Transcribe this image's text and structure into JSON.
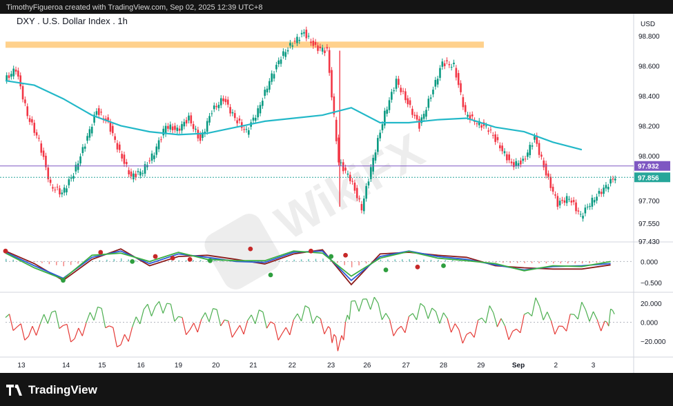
{
  "header": {
    "attribution": "TimothyFigueroa created with TradingView.com, Sep 02, 2025 12:39 UTC+8"
  },
  "brand": {
    "name": "TradingView"
  },
  "chart_data": {
    "type": "candlestick",
    "title": "DXY . U.S. Dollar Index . 1h",
    "currency": "USD",
    "x_ticks": [
      "13",
      "14",
      "15",
      "16",
      "19",
      "20",
      "21",
      "22",
      "23",
      "26",
      "27",
      "28",
      "29",
      "Sep",
      "2",
      "3"
    ],
    "price_ticks": [
      "98.800",
      "98.600",
      "98.400",
      "98.200",
      "98.000",
      "97.700",
      "97.550",
      "97.430"
    ],
    "price_ticks_values": [
      98.8,
      98.6,
      98.4,
      98.2,
      98.0,
      97.7,
      97.55,
      97.43
    ],
    "ylim": [
      97.43,
      98.9
    ],
    "price_labels": [
      {
        "text": "97.932",
        "value": 97.932,
        "color": "#7e57c2"
      },
      {
        "text": "97.856",
        "value": 97.856,
        "color": "#26a69a"
      }
    ],
    "resistance_zone": {
      "value": 98.74
    },
    "moving_average": {
      "color": "#22b8c8",
      "points": [
        [
          0,
          98.5
        ],
        [
          1,
          98.47
        ],
        [
          2,
          98.38
        ],
        [
          3,
          98.27
        ],
        [
          4,
          98.2
        ],
        [
          5,
          98.16
        ],
        [
          6,
          98.14
        ],
        [
          7,
          98.15
        ],
        [
          8,
          98.19
        ],
        [
          9,
          98.23
        ],
        [
          10,
          98.25
        ],
        [
          11,
          98.27
        ],
        [
          12,
          98.32
        ],
        [
          13,
          98.22
        ],
        [
          14,
          98.22
        ],
        [
          15,
          98.24
        ],
        [
          16,
          98.25
        ],
        [
          17,
          98.19
        ],
        [
          18,
          98.16
        ],
        [
          19,
          98.09
        ],
        [
          20,
          98.04
        ]
      ]
    },
    "price_series": [
      [
        0,
        98.5
      ],
      [
        0.4,
        98.58
      ],
      [
        0.8,
        98.27
      ],
      [
        1.2,
        98.1
      ],
      [
        1.6,
        97.8
      ],
      [
        2,
        97.75
      ],
      [
        2.4,
        97.88
      ],
      [
        2.8,
        98.08
      ],
      [
        3.2,
        98.3
      ],
      [
        3.6,
        98.22
      ],
      [
        4,
        98.02
      ],
      [
        4.4,
        97.86
      ],
      [
        4.8,
        97.9
      ],
      [
        5.2,
        98.02
      ],
      [
        5.6,
        98.2
      ],
      [
        6,
        98.17
      ],
      [
        6.4,
        98.25
      ],
      [
        6.8,
        98.1
      ],
      [
        7.2,
        98.3
      ],
      [
        7.6,
        98.38
      ],
      [
        8,
        98.25
      ],
      [
        8.4,
        98.16
      ],
      [
        8.8,
        98.3
      ],
      [
        9.2,
        98.5
      ],
      [
        9.6,
        98.66
      ],
      [
        10,
        98.75
      ],
      [
        10.4,
        98.82
      ],
      [
        10.8,
        98.72
      ],
      [
        11.2,
        98.7
      ],
      [
        11.6,
        97.96
      ],
      [
        12,
        97.85
      ],
      [
        12.4,
        97.65
      ],
      [
        12.8,
        97.98
      ],
      [
        13.2,
        98.28
      ],
      [
        13.6,
        98.5
      ],
      [
        14,
        98.35
      ],
      [
        14.4,
        98.2
      ],
      [
        14.8,
        98.4
      ],
      [
        15.2,
        98.62
      ],
      [
        15.6,
        98.6
      ],
      [
        16,
        98.28
      ],
      [
        16.4,
        98.22
      ],
      [
        16.8,
        98.18
      ],
      [
        17.2,
        98.06
      ],
      [
        17.6,
        97.94
      ],
      [
        18,
        97.96
      ],
      [
        18.4,
        98.12
      ],
      [
        18.8,
        97.88
      ],
      [
        19.2,
        97.68
      ],
      [
        19.6,
        97.72
      ],
      [
        20,
        97.6
      ],
      [
        20.4,
        97.7
      ],
      [
        20.8,
        97.78
      ],
      [
        21.2,
        97.86
      ]
    ],
    "oscillator": {
      "ticks": [
        "0.000",
        "−0.500"
      ],
      "ticks_values": [
        0.0,
        -0.5
      ],
      "lines": [
        {
          "name": "",
          "color": "#8b1a1a",
          "points": [
            [
              0,
              0.25
            ],
            [
              1,
              -0.05
            ],
            [
              2,
              -0.45
            ],
            [
              3,
              0.05
            ],
            [
              4,
              0.3
            ],
            [
              5,
              -0.1
            ],
            [
              6,
              0.12
            ],
            [
              7,
              0.15
            ],
            [
              8,
              0.05
            ],
            [
              9,
              -0.06
            ],
            [
              10,
              0.18
            ],
            [
              11,
              0.28
            ],
            [
              12,
              -0.55
            ],
            [
              13,
              0.18
            ],
            [
              14,
              0.22
            ],
            [
              15,
              0.15
            ],
            [
              16,
              0.1
            ],
            [
              17,
              -0.1
            ],
            [
              18,
              -0.15
            ],
            [
              19,
              -0.18
            ],
            [
              20,
              -0.18
            ],
            [
              21,
              -0.08
            ]
          ]
        },
        {
          "name": "",
          "color": "#2a5bd7",
          "points": [
            [
              0,
              0.22
            ],
            [
              1,
              -0.1
            ],
            [
              2,
              -0.4
            ],
            [
              3,
              0.1
            ],
            [
              4,
              0.25
            ],
            [
              5,
              -0.05
            ],
            [
              6,
              0.18
            ],
            [
              7,
              0.1
            ],
            [
              8,
              0.0
            ],
            [
              9,
              -0.02
            ],
            [
              10,
              0.22
            ],
            [
              11,
              0.25
            ],
            [
              12,
              -0.45
            ],
            [
              13,
              0.12
            ],
            [
              14,
              0.25
            ],
            [
              15,
              0.12
            ],
            [
              16,
              0.05
            ],
            [
              17,
              -0.08
            ],
            [
              18,
              -0.2
            ],
            [
              19,
              -0.12
            ],
            [
              20,
              -0.1
            ],
            [
              21,
              -0.05
            ]
          ]
        },
        {
          "name": "",
          "color": "#3cb043",
          "points": [
            [
              0,
              0.2
            ],
            [
              1,
              -0.15
            ],
            [
              2,
              -0.42
            ],
            [
              3,
              0.15
            ],
            [
              4,
              0.2
            ],
            [
              5,
              0.0
            ],
            [
              6,
              0.22
            ],
            [
              7,
              0.05
            ],
            [
              8,
              0.02
            ],
            [
              9,
              0.02
            ],
            [
              10,
              0.25
            ],
            [
              11,
              0.2
            ],
            [
              12,
              -0.35
            ],
            [
              13,
              0.08
            ],
            [
              14,
              0.24
            ],
            [
              15,
              0.08
            ],
            [
              16,
              0.02
            ],
            [
              17,
              -0.05
            ],
            [
              18,
              -0.22
            ],
            [
              19,
              -0.1
            ],
            [
              20,
              -0.12
            ],
            [
              21,
              0.0
            ]
          ]
        }
      ],
      "ylim": [
        -0.7,
        0.45
      ]
    },
    "cci": {
      "ticks": [
        "20.000",
        "0.000",
        "−20.000"
      ],
      "ticks_values": [
        20,
        0,
        -20
      ],
      "ylim": [
        -35,
        30
      ],
      "points": [
        [
          0,
          5
        ],
        [
          0.8,
          -15
        ],
        [
          1.6,
          10
        ],
        [
          2.4,
          -18
        ],
        [
          3.2,
          15
        ],
        [
          4,
          -25
        ],
        [
          4.8,
          12
        ],
        [
          5.6,
          18
        ],
        [
          6.4,
          -10
        ],
        [
          7.2,
          12
        ],
        [
          8,
          -12
        ],
        [
          8.8,
          10
        ],
        [
          9.6,
          -15
        ],
        [
          10.4,
          14
        ],
        [
          11.2,
          -8
        ],
        [
          11.6,
          -25
        ],
        [
          12,
          18
        ],
        [
          12.8,
          22
        ],
        [
          13.6,
          -12
        ],
        [
          14.4,
          15
        ],
        [
          15.2,
          5
        ],
        [
          16,
          -18
        ],
        [
          16.8,
          12
        ],
        [
          17.6,
          -15
        ],
        [
          18.4,
          20
        ],
        [
          19.2,
          -10
        ],
        [
          20,
          15
        ],
        [
          20.8,
          -5
        ],
        [
          21.2,
          20
        ]
      ]
    },
    "watermark": "WikiFX"
  }
}
